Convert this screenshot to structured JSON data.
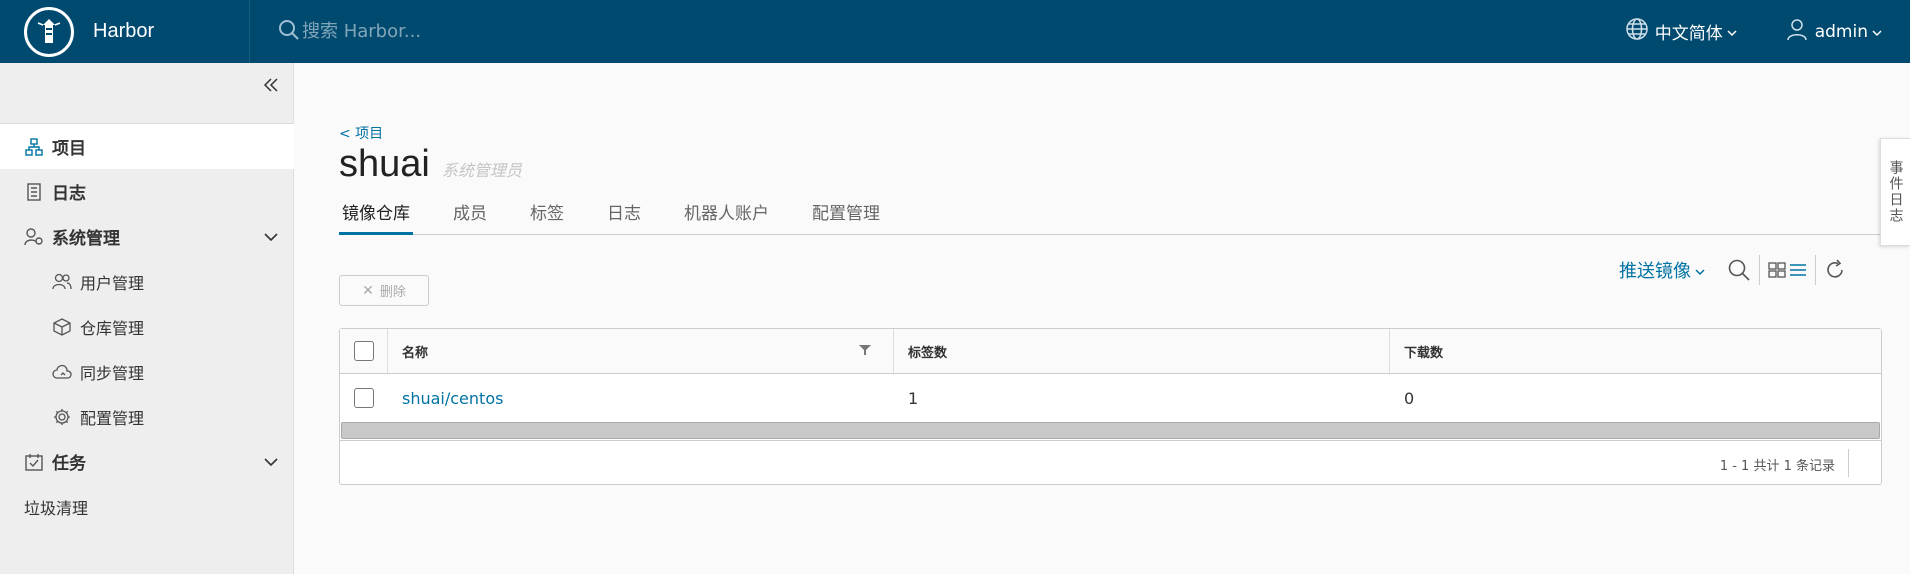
{
  "header": {
    "brand": "Harbor",
    "search_placeholder": "搜索 Harbor...",
    "language": "中文简体",
    "user": "admin"
  },
  "sidebar": {
    "items": [
      {
        "label": "项目",
        "icon": "projects-icon",
        "active": true
      },
      {
        "label": "日志",
        "icon": "logs-icon"
      },
      {
        "label": "系统管理",
        "icon": "admin-icon",
        "expandable": true
      },
      {
        "label": "用户管理",
        "icon": "users-icon"
      },
      {
        "label": "仓库管理",
        "icon": "registry-icon"
      },
      {
        "label": "同步管理",
        "icon": "replication-icon"
      },
      {
        "label": "配置管理",
        "icon": "config-icon"
      },
      {
        "label": "任务",
        "icon": "tasks-icon",
        "expandable": true
      },
      {
        "label": "垃圾清理"
      }
    ]
  },
  "breadcrumb": "< 项目",
  "project": {
    "name": "shuai",
    "role": "系统管理员"
  },
  "tabs": [
    "镜像仓库",
    "成员",
    "标签",
    "日志",
    "机器人账户",
    "配置管理"
  ],
  "toolbar": {
    "push_label": "推送镜像",
    "delete_label": "删除"
  },
  "table": {
    "headers": [
      "名称",
      "标签数",
      "下载数"
    ],
    "rows": [
      {
        "name": "shuai/centos",
        "tags": "1",
        "downloads": "0"
      }
    ],
    "pagination": "1 - 1 共计 1 条记录"
  },
  "side_tab": "事件日志",
  "colors": {
    "header_bg": "#004a70",
    "accent": "#0072a3",
    "sidebar_bg": "#eeeeee"
  }
}
